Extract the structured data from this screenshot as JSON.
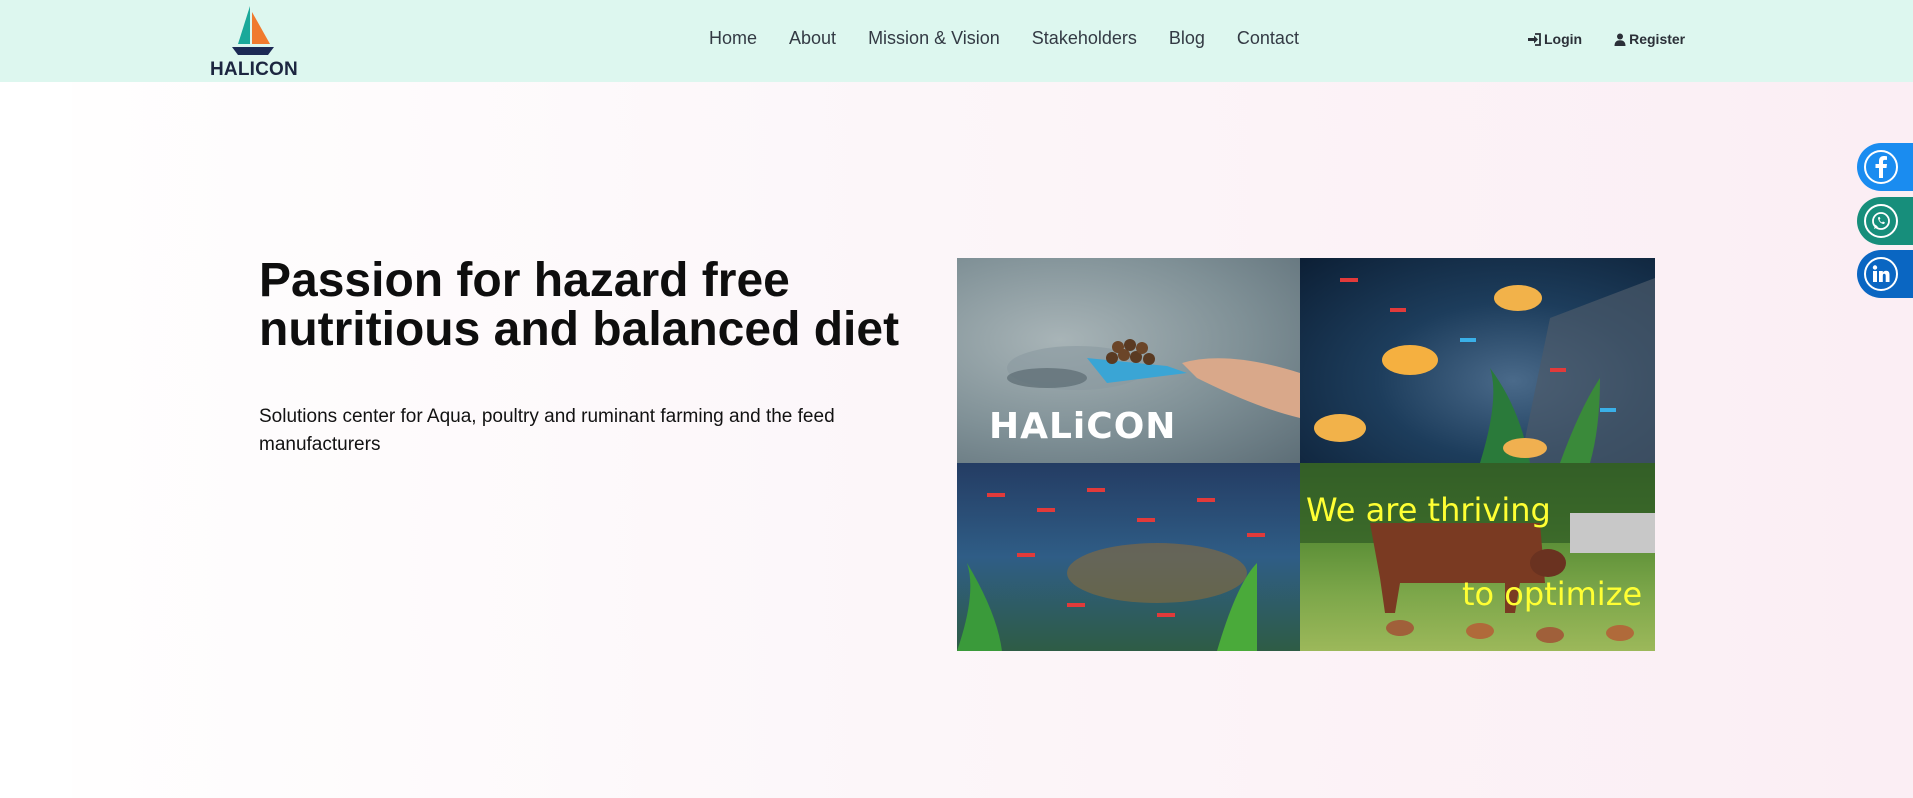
{
  "brand": {
    "name": "HALICON"
  },
  "nav": {
    "items": [
      {
        "label": "Home"
      },
      {
        "label": "About"
      },
      {
        "label": "Mission & Vision"
      },
      {
        "label": "Stakeholders"
      },
      {
        "label": "Blog"
      },
      {
        "label": "Contact"
      }
    ]
  },
  "auth": {
    "login_label": "Login",
    "register_label": "Register"
  },
  "hero": {
    "heading": "Passion for hazard free nutritious and balanced diet",
    "subtitle": "Solutions center for Aqua, poultry and ruminant farming and the feed manufacturers"
  },
  "collage": {
    "mark": "HALiCON",
    "line1": "We are thriving",
    "line2": "to optimize"
  },
  "social": [
    "facebook-icon",
    "whatsapp-icon",
    "linkedin-icon"
  ],
  "colors": {
    "header_bg": "#ddf7ef",
    "facebook": "#1a8cf0",
    "whatsapp": "#178e7b",
    "linkedin": "#0a66c2",
    "overlay_text": "#ffff33"
  }
}
